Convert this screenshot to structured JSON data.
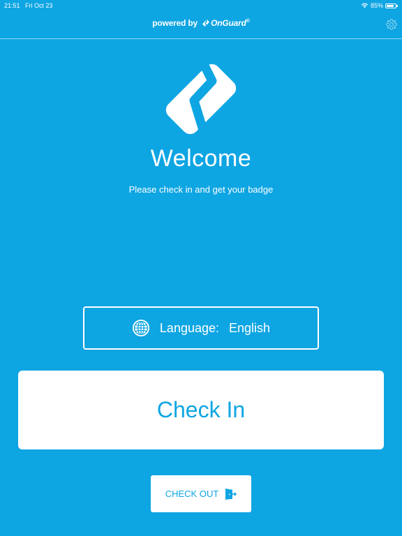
{
  "status_bar": {
    "time": "21:51",
    "date": "Fri Oct 23",
    "battery": "85%",
    "battery_level": 0.85
  },
  "header": {
    "powered_prefix": "powered by",
    "brand": "OnGuard",
    "trademark": "®"
  },
  "welcome": {
    "title": "Welcome",
    "subtitle": "Please check in and get your badge"
  },
  "language": {
    "label": "Language:",
    "value": "English"
  },
  "actions": {
    "check_in": "Check In",
    "check_out": "CHECK OUT"
  },
  "colors": {
    "background": "#0ea5e3",
    "foreground": "#ffffff"
  }
}
